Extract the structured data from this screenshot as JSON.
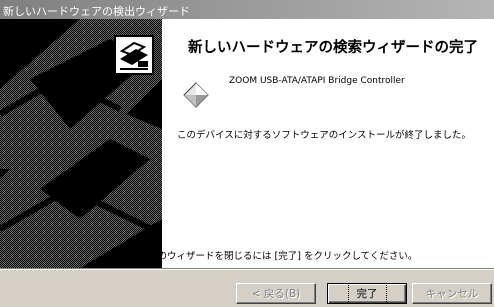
{
  "window": {
    "title": "新しいハードウェアの検出ウィザード"
  },
  "main": {
    "heading": "新しいハードウェアの検索ウィザードの完了",
    "device_name": "ZOOM USB-ATA/ATAPI Bridge Controller",
    "install_done": "このデバイスに対するソフトウェアのインストールが終了しました。",
    "close_instruction": "このウィザードを閉じるには [完了] をクリックしてください。"
  },
  "buttons": {
    "back": "< 戻る(B)",
    "finish": "完了",
    "cancel": "キャンセル"
  },
  "icons": {
    "banner": "hardware-wizard-banner-icon",
    "device": "device-diamond-icon"
  }
}
